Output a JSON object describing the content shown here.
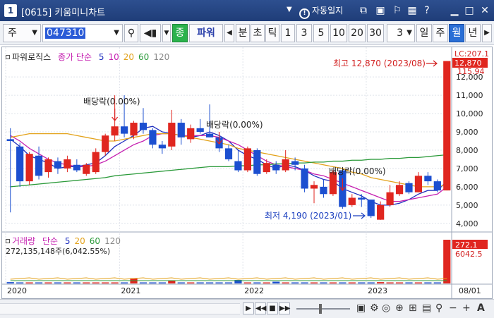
{
  "window": {
    "number": "1",
    "title": "[0615] 키움미니차트",
    "autolock_label": "자동일지"
  },
  "toolbar": {
    "period_select": "주",
    "code": "047310",
    "type_btn": "종",
    "name": "파워",
    "period_buttons": [
      "분",
      "초",
      "틱"
    ],
    "minute_buttons": [
      "1",
      "3",
      "5",
      "10",
      "20",
      "30"
    ],
    "count_select": "3",
    "cycle_buttons": [
      "일",
      "주",
      "월",
      "년"
    ],
    "active_cycle": "월"
  },
  "chart": {
    "legend_name": "파워로직스",
    "legend_ma_label": "종가 단순",
    "ma_periods": [
      {
        "label": "5",
        "color": "#1f2fbf"
      },
      {
        "label": "10",
        "color": "#c51fb0"
      },
      {
        "label": "20",
        "color": "#e3a21a"
      },
      {
        "label": "60",
        "color": "#2b9a3a"
      },
      {
        "label": "120",
        "color": "#8a8a8a"
      }
    ],
    "high_label": "최고 12,870 (2023/08)",
    "low_label": "최저 4,190 (2023/01)",
    "dividend_labels": [
      "배당락(0.00%)",
      "배당락(0.00%)",
      "배당락(0.00%)"
    ],
    "price_ticks": [
      "12,000",
      "11,000",
      "10,000",
      "9,000",
      "8,000",
      "7,000",
      "6,000",
      "5,000",
      "4,000"
    ],
    "top_tag": "LC:207.1",
    "current_price": "12,870",
    "prev_tag": "115.94",
    "x_ticks": [
      "2020",
      "2021",
      "2022",
      "2023",
      "08/01"
    ]
  },
  "volume": {
    "legend_name": "거래량",
    "legend_ma_label": "단순",
    "ma_periods": [
      {
        "label": "5",
        "color": "#1f2fbf"
      },
      {
        "label": "20",
        "color": "#e3a21a"
      },
      {
        "label": "60",
        "color": "#2b9a3a"
      },
      {
        "label": "120",
        "color": "#8a8a8a"
      }
    ],
    "info": "272,135,148주(6,042.55%)",
    "current_tag": "272,1",
    "ratio_tag": "6042.5"
  },
  "chart_data": {
    "type": "candlestick",
    "title": "파워로직스",
    "x_axis": [
      "2020",
      "2021",
      "2022",
      "2023",
      "08/01"
    ],
    "y_range": [
      3800,
      13200
    ],
    "candles": [
      {
        "o": 8600,
        "h": 9200,
        "l": 4600,
        "c": 8500
      },
      {
        "o": 8200,
        "h": 8400,
        "l": 6000,
        "c": 6300
      },
      {
        "o": 6300,
        "h": 7900,
        "l": 6100,
        "c": 7800
      },
      {
        "o": 7700,
        "h": 8200,
        "l": 6400,
        "c": 6600
      },
      {
        "o": 6800,
        "h": 7600,
        "l": 6500,
        "c": 7500
      },
      {
        "o": 7400,
        "h": 7600,
        "l": 6700,
        "c": 7000
      },
      {
        "o": 7000,
        "h": 7700,
        "l": 6800,
        "c": 7500
      },
      {
        "o": 7200,
        "h": 7500,
        "l": 6800,
        "c": 6900
      },
      {
        "o": 6700,
        "h": 7300,
        "l": 6600,
        "c": 7200
      },
      {
        "o": 6800,
        "h": 8100,
        "l": 6700,
        "c": 7900
      },
      {
        "o": 7900,
        "h": 8900,
        "l": 7700,
        "c": 8800
      },
      {
        "o": 8800,
        "h": 11000,
        "l": 8500,
        "c": 9300
      },
      {
        "o": 9300,
        "h": 11000,
        "l": 8700,
        "c": 8900
      },
      {
        "o": 8800,
        "h": 9600,
        "l": 8600,
        "c": 9500
      },
      {
        "o": 9500,
        "h": 10300,
        "l": 8900,
        "c": 9100
      },
      {
        "o": 9100,
        "h": 9200,
        "l": 8100,
        "c": 8300
      },
      {
        "o": 8300,
        "h": 8500,
        "l": 7800,
        "c": 8100
      },
      {
        "o": 8200,
        "h": 10200,
        "l": 8000,
        "c": 9500
      },
      {
        "o": 9500,
        "h": 9700,
        "l": 8300,
        "c": 8700
      },
      {
        "o": 8600,
        "h": 9400,
        "l": 8400,
        "c": 9200
      },
      {
        "o": 9200,
        "h": 9700,
        "l": 8900,
        "c": 9000
      },
      {
        "o": 8900,
        "h": 10500,
        "l": 8700,
        "c": 8700
      },
      {
        "o": 8700,
        "h": 8900,
        "l": 7900,
        "c": 8100
      },
      {
        "o": 8100,
        "h": 8300,
        "l": 7400,
        "c": 7500
      },
      {
        "o": 7400,
        "h": 8000,
        "l": 6800,
        "c": 6900
      },
      {
        "o": 6900,
        "h": 8200,
        "l": 6800,
        "c": 8100
      },
      {
        "o": 8000,
        "h": 8100,
        "l": 6600,
        "c": 6700
      },
      {
        "o": 6800,
        "h": 7500,
        "l": 6700,
        "c": 7300
      },
      {
        "o": 7200,
        "h": 7400,
        "l": 6700,
        "c": 6900
      },
      {
        "o": 6900,
        "h": 8000,
        "l": 6800,
        "c": 7500
      },
      {
        "o": 7400,
        "h": 7600,
        "l": 6900,
        "c": 7200
      },
      {
        "o": 7000,
        "h": 7200,
        "l": 5700,
        "c": 5900
      },
      {
        "o": 5900,
        "h": 6300,
        "l": 5100,
        "c": 6100
      },
      {
        "o": 6000,
        "h": 6400,
        "l": 5400,
        "c": 5600
      },
      {
        "o": 5600,
        "h": 6900,
        "l": 5500,
        "c": 6800
      },
      {
        "o": 6900,
        "h": 6900,
        "l": 4800,
        "c": 4900
      },
      {
        "o": 5000,
        "h": 5600,
        "l": 4900,
        "c": 5400
      },
      {
        "o": 5400,
        "h": 5600,
        "l": 4900,
        "c": 5300
      },
      {
        "o": 5300,
        "h": 5300,
        "l": 4300,
        "c": 4400
      },
      {
        "o": 4200,
        "h": 5200,
        "l": 4190,
        "c": 5000
      },
      {
        "o": 5000,
        "h": 6100,
        "l": 4900,
        "c": 5700
      },
      {
        "o": 5600,
        "h": 6300,
        "l": 5500,
        "c": 6100
      },
      {
        "o": 6200,
        "h": 6300,
        "l": 5600,
        "c": 5700
      },
      {
        "o": 5700,
        "h": 6800,
        "l": 5700,
        "c": 6600
      },
      {
        "o": 6600,
        "h": 6800,
        "l": 6100,
        "c": 6300
      },
      {
        "o": 6300,
        "h": 6400,
        "l": 5700,
        "c": 5800
      },
      {
        "o": 5800,
        "h": 12870,
        "l": 5800,
        "c": 12870
      }
    ],
    "ma_series": [
      {
        "name": "5",
        "color": "#1f2fbf",
        "values": [
          8600,
          8200,
          7700,
          7500,
          7300,
          7000,
          7100,
          7100,
          7200,
          7300,
          7700,
          8200,
          8500,
          8800,
          9200,
          9300,
          9000,
          8900,
          8800,
          8700,
          8800,
          9000,
          8800,
          8500,
          8000,
          7700,
          7500,
          7200,
          7000,
          7200,
          7100,
          6900,
          6600,
          6400,
          6300,
          5900,
          5700,
          5500,
          5200,
          5000,
          5000,
          5100,
          5300,
          5600,
          5800,
          5800,
          6300
        ]
      },
      {
        "name": "10",
        "color": "#c51fb0",
        "values": [
          8800,
          8500,
          8100,
          7800,
          7500,
          7300,
          7200,
          7100,
          7100,
          7200,
          7400,
          7700,
          8000,
          8300,
          8500,
          8800,
          8900,
          8900,
          8800,
          8800,
          8800,
          8800,
          8700,
          8500,
          8300,
          8000,
          7700,
          7400,
          7200,
          7100,
          7000,
          6900,
          6700,
          6600,
          6400,
          6200,
          6000,
          5800,
          5600,
          5400,
          5200,
          5200,
          5300,
          5400,
          5500,
          5600,
          6000
        ]
      },
      {
        "name": "20",
        "color": "#e3a21a",
        "values": [
          8700,
          8800,
          8900,
          8900,
          8900,
          8900,
          8900,
          8800,
          8700,
          8600,
          8500,
          8500,
          8600,
          8700,
          8800,
          8900,
          8900,
          8900,
          8800,
          8700,
          8600,
          8500,
          8400,
          8300,
          8100,
          8000,
          7900,
          7800,
          7700,
          7600,
          7500,
          7400,
          7300,
          7200,
          7100,
          7000,
          6800,
          6700,
          6500,
          6400,
          6300,
          6200,
          6100,
          6000,
          6000,
          6000,
          6100
        ]
      },
      {
        "name": "60",
        "color": "#2b9a3a",
        "values": [
          6000,
          6050,
          6100,
          6150,
          6200,
          6250,
          6300,
          6350,
          6400,
          6450,
          6500,
          6600,
          6650,
          6700,
          6750,
          6800,
          6850,
          6900,
          6950,
          7000,
          7050,
          7100,
          7100,
          7100,
          7150,
          7150,
          7200,
          7200,
          7250,
          7250,
          7300,
          7300,
          7350,
          7350,
          7400,
          7400,
          7450,
          7450,
          7500,
          7500,
          7550,
          7550,
          7600,
          7600,
          7650,
          7700,
          7750
        ]
      }
    ],
    "volume_bars": [
      3,
      1,
      2,
      1,
      1,
      1,
      1,
      1,
      1,
      1,
      1,
      1,
      1,
      12,
      1,
      1,
      1,
      6,
      1,
      2,
      1,
      1,
      1,
      1,
      8,
      2,
      1,
      1,
      4,
      2,
      1,
      2,
      1,
      1,
      1,
      2,
      1,
      1,
      2,
      3,
      1,
      1,
      2,
      1,
      1,
      1,
      100
    ]
  }
}
